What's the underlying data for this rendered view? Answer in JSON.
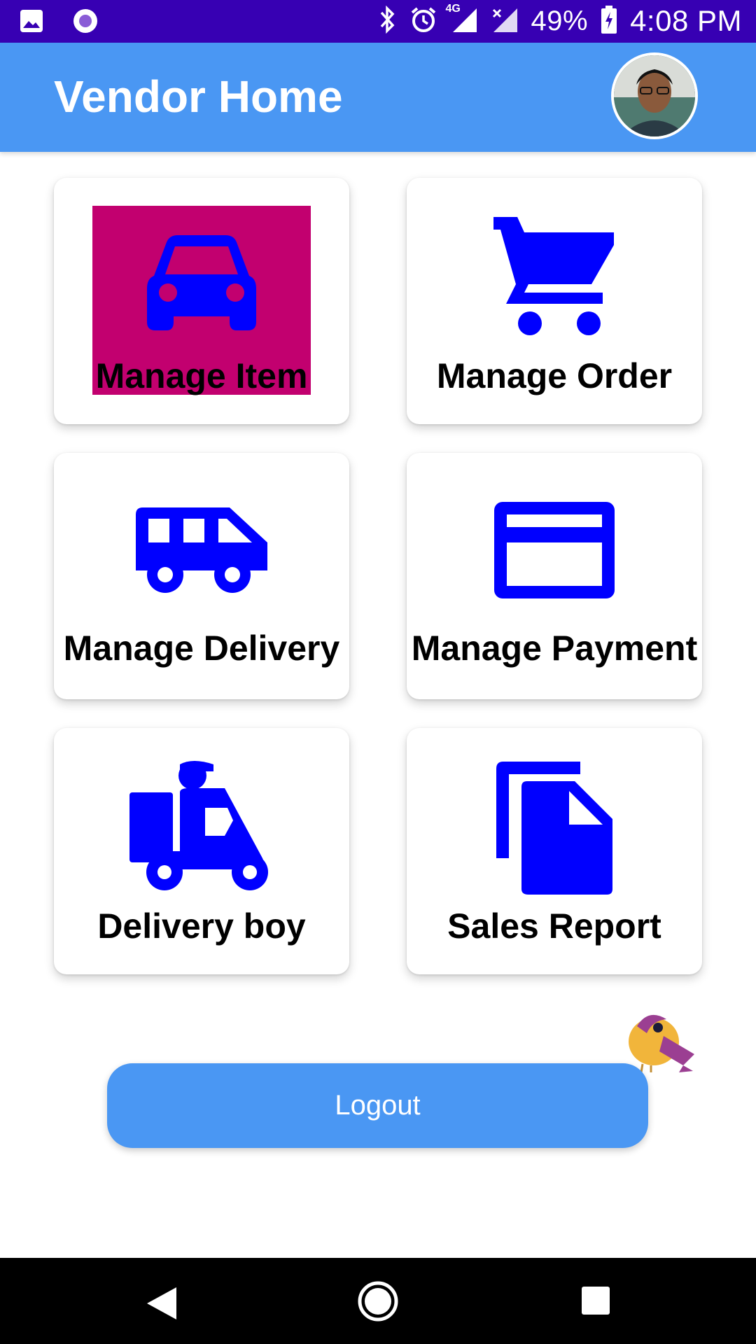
{
  "status_bar": {
    "battery": "49%",
    "time": "4:08 PM",
    "network": "4G",
    "icons": [
      "image-icon",
      "record-icon",
      "bluetooth-icon",
      "alarm-icon",
      "signal-icon",
      "signal-no-data-icon",
      "battery-charging-icon"
    ]
  },
  "app_bar": {
    "title": "Vendor Home",
    "avatar": "profile-avatar"
  },
  "menu": {
    "items": [
      {
        "label": "Manage Item",
        "icon": "car-icon"
      },
      {
        "label": "Manage Order",
        "icon": "cart-icon"
      },
      {
        "label": "Manage Delivery",
        "icon": "van-icon"
      },
      {
        "label": "Manage Payment",
        "icon": "credit-card-icon"
      },
      {
        "label": "Delivery boy",
        "icon": "delivery-scooter-icon"
      },
      {
        "label": "Sales Report",
        "icon": "documents-icon"
      }
    ]
  },
  "logout": {
    "label": "Logout"
  },
  "colors": {
    "status_bar": "#3700b3",
    "app_bar": "#4a97f3",
    "icon": "#0000ff",
    "highlight": "#c2006f",
    "button": "#4a97f3"
  }
}
